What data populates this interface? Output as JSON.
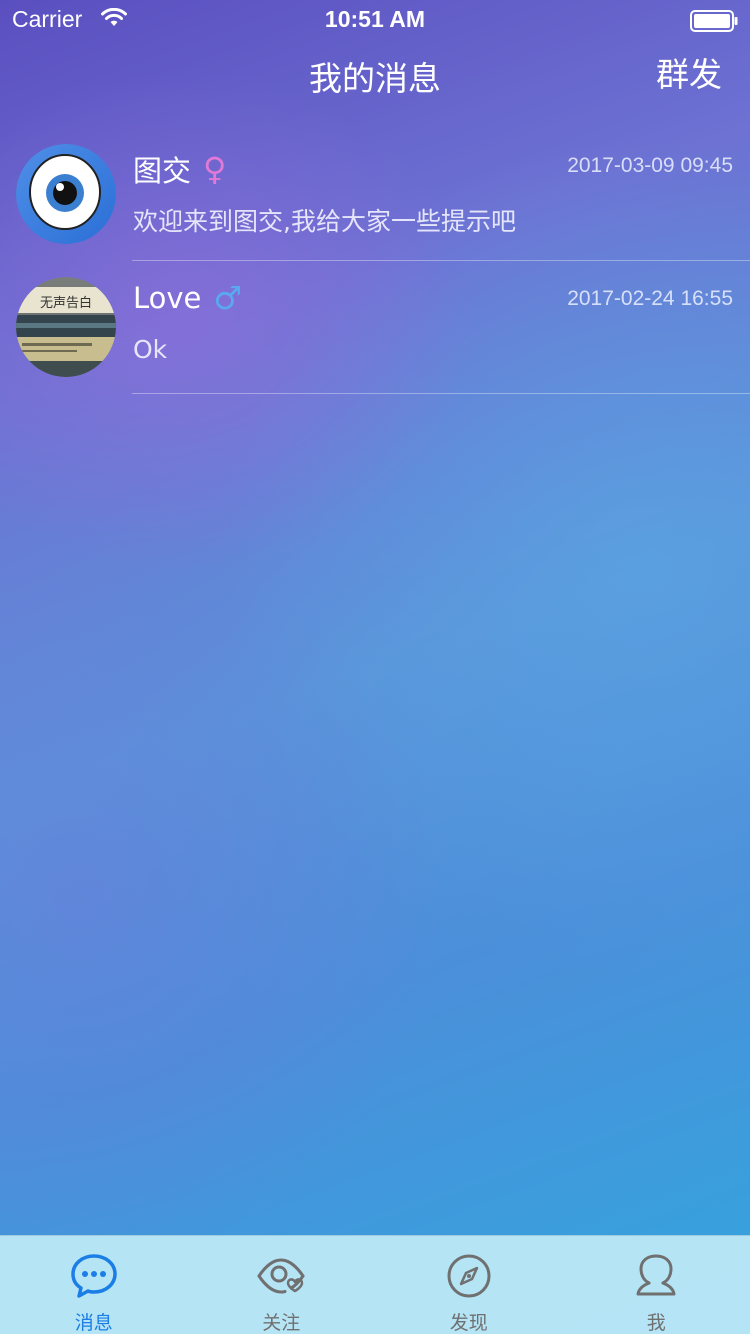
{
  "status_bar": {
    "carrier": "Carrier",
    "time": "10:51 AM"
  },
  "nav": {
    "title": "我的消息",
    "action": "群发"
  },
  "messages": [
    {
      "name": "图交",
      "gender": "female",
      "gender_symbol": "♀",
      "time": "2017-03-09 09:45",
      "preview": "欢迎来到图交,我给大家一些提示吧",
      "avatar": "eye-logo"
    },
    {
      "name": "Love",
      "gender": "male",
      "gender_symbol": "♂",
      "time": "2017-02-24 16:55",
      "preview": "Ok",
      "avatar": "photo"
    }
  ],
  "avatar_text": "无声告白",
  "tabs": [
    {
      "label": "消息",
      "icon": "chat-bubble-icon",
      "active": true
    },
    {
      "label": "关注",
      "icon": "eye-heart-icon",
      "active": false
    },
    {
      "label": "发现",
      "icon": "compass-icon",
      "active": false
    },
    {
      "label": "我",
      "icon": "person-icon",
      "active": false
    }
  ],
  "colors": {
    "active_tab": "#1a7ee6",
    "inactive_tab": "#707070",
    "female": "#e07ad6",
    "male": "#5aa9ee"
  }
}
